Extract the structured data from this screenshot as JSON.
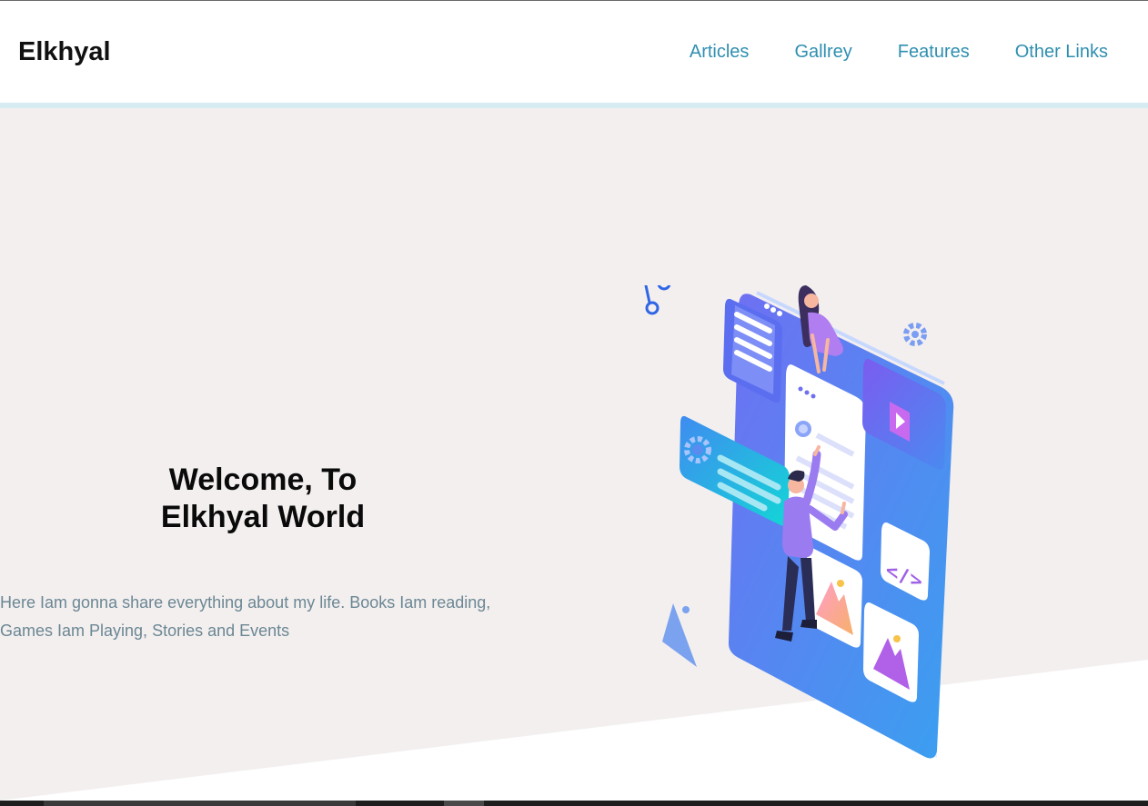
{
  "header": {
    "logo": "Elkhyal",
    "nav": {
      "articles": "Articles",
      "gallery": "Gallrey",
      "features": "Features",
      "other_links": "Other Links"
    }
  },
  "landing": {
    "title_line1": "Welcome, To",
    "title_line2": "Elkhyal World",
    "intro": "Here Iam gonna share everything about my life. Books Iam reading, Games Iam Playing, Stories and Events"
  },
  "colors": {
    "nav_link": "#2f8fb0",
    "landing_bg": "#f3efef",
    "header_border": "#d6ebf2",
    "intro_text": "#6b8793"
  },
  "icons": [
    "share-icon",
    "gear-icon",
    "code-icon",
    "image-icon",
    "play-icon"
  ]
}
